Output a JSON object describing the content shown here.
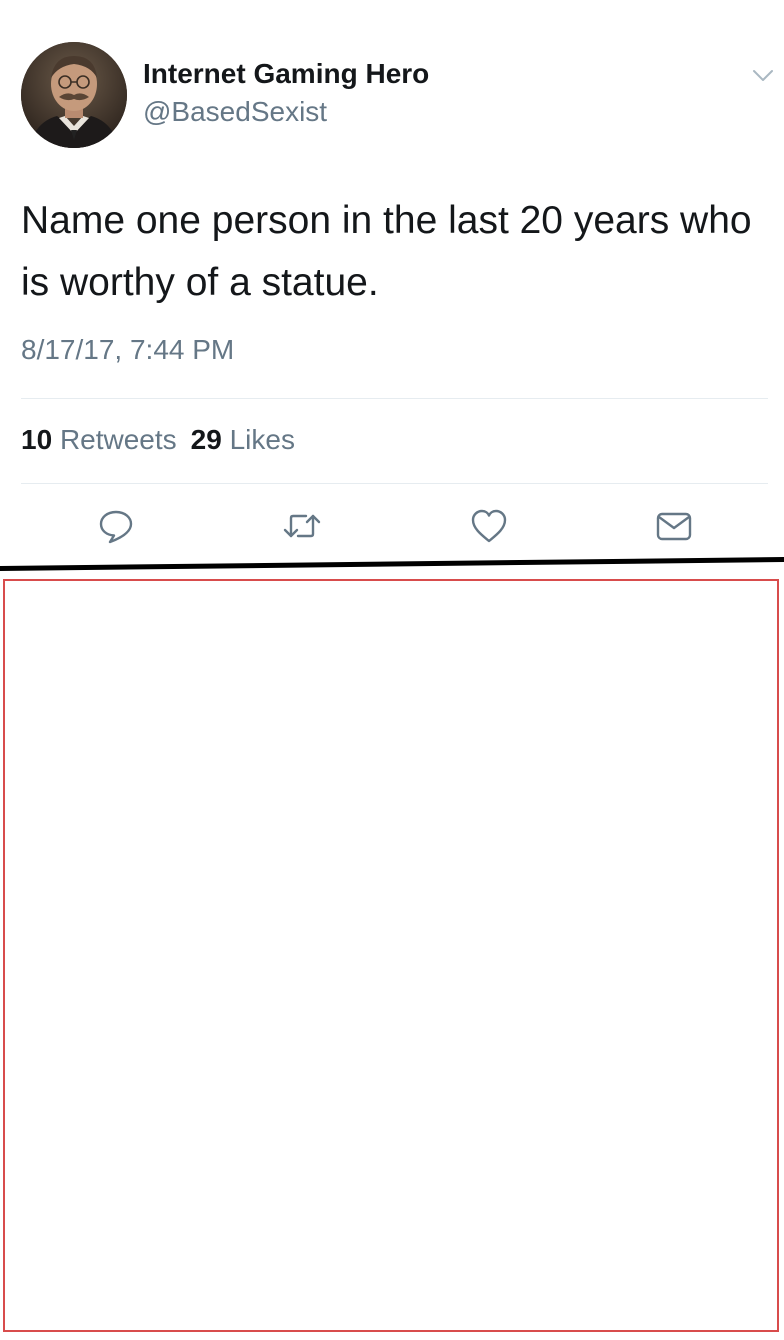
{
  "tweet": {
    "author": {
      "display_name": "Internet Gaming Hero",
      "handle": "@BasedSexist"
    },
    "text": "Name one person in the last 20 years who is worthy of a statue.",
    "timestamp": "8/17/17, 7:44 PM",
    "stats": {
      "retweets_count": "10",
      "retweets_label": "Retweets",
      "likes_count": "29",
      "likes_label": "Likes"
    },
    "actions": [
      {
        "icon": "reply-icon"
      },
      {
        "icon": "retweet-icon"
      },
      {
        "icon": "like-icon"
      },
      {
        "icon": "direct-message-icon"
      }
    ]
  },
  "colors": {
    "text_primary": "#14171a",
    "text_secondary": "#657786",
    "icon": "#657786",
    "divider": "#e6ecf0",
    "panel_border": "#d84c4c"
  }
}
